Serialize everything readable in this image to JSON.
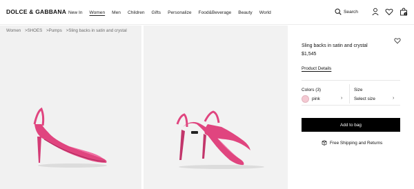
{
  "header": {
    "brand": "DOLCE & GABBANA",
    "nav": [
      "New In",
      "Women",
      "Men",
      "Children",
      "Gifts",
      "Personalize",
      "Food&Beverage",
      "Beauty",
      "World"
    ],
    "active_nav": "Women",
    "search_label": "Search",
    "cart_count": "0",
    "icons": [
      "search-icon",
      "account-icon",
      "wishlist-heart-icon",
      "cart-bag-icon"
    ]
  },
  "breadcrumb": [
    "Women",
    ">SHOES",
    ">Pumps",
    ">Sling backs in satin and crystal"
  ],
  "product": {
    "title": "Sling backs in satin and crystal",
    "price": "$1,545",
    "details_link": "Product Details",
    "colors_label": "Colors (3)",
    "selected_color": "pink",
    "size_label": "Size",
    "size_value": "Select size",
    "add_to_bag": "Add to bag",
    "shipping": "Free Shipping and Returns"
  },
  "colors": {
    "accent": "#000000",
    "swatch_pink": "#f4c9d2",
    "shoe_pink": "#e0457f",
    "gallery_bg": "#f1f1f1"
  }
}
